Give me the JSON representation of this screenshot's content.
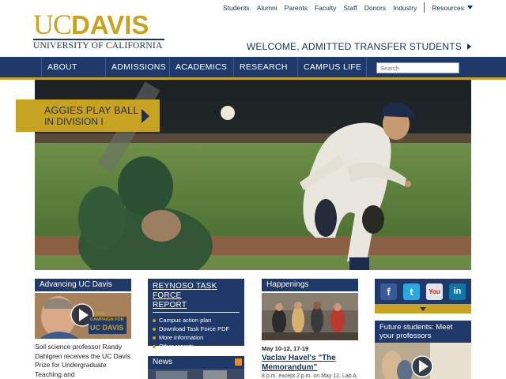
{
  "utility_nav": {
    "links": [
      "Students",
      "Alumni",
      "Parents",
      "Faculty",
      "Staff",
      "Donors",
      "Industry"
    ],
    "resources_label": "Resources"
  },
  "logo": {
    "uc": "UC",
    "davis": "DAVIS",
    "university": "UNIVERSITY OF CALIFORNIA"
  },
  "welcome": "WELCOME, ADMITTED TRANSFER STUDENTS",
  "main_nav": [
    "ABOUT",
    "ADMISSIONS",
    "ACADEMICS",
    "RESEARCH",
    "CAMPUS LIFE"
  ],
  "search": {
    "placeholder": "Search"
  },
  "hero": {
    "banner_line1": "AGGIES PLAY BALL",
    "banner_line2": "IN DIVISION I"
  },
  "advancing": {
    "header": "Advancing UC Davis",
    "video_text_top": "FOR",
    "video_text_mid": "CAMPAIGN FOR",
    "video_text_brand": "UC DAVIS",
    "body": "Soil science professor Randy Dahlgren receives the UC Davis Prize for Undergraduate Teaching and"
  },
  "task_force": {
    "title_line1": "REYNOSO TASK FORCE",
    "title_line2": "REPORT",
    "links": [
      "Campus action plan",
      "Download Task Force PDF",
      "More information",
      "Other reports"
    ]
  },
  "news": {
    "header": "News"
  },
  "happenings": {
    "header": "Happenings",
    "date": "May 10-12, 17-19",
    "event_line1": "Vaclav Havel's \"The",
    "event_line2": "Memorandum\"",
    "subtext": "8 p.m. except 2 p.m. on May 12, Lab A"
  },
  "social": {
    "icons": [
      "facebook-icon",
      "twitter-icon",
      "youtube-icon",
      "linkedin-icon"
    ]
  },
  "future": {
    "header": "Future students: Meet your professors"
  },
  "colors": {
    "navy": "#1f3a6a",
    "gold": "#c8a221",
    "text_navy": "#1a2f57"
  }
}
